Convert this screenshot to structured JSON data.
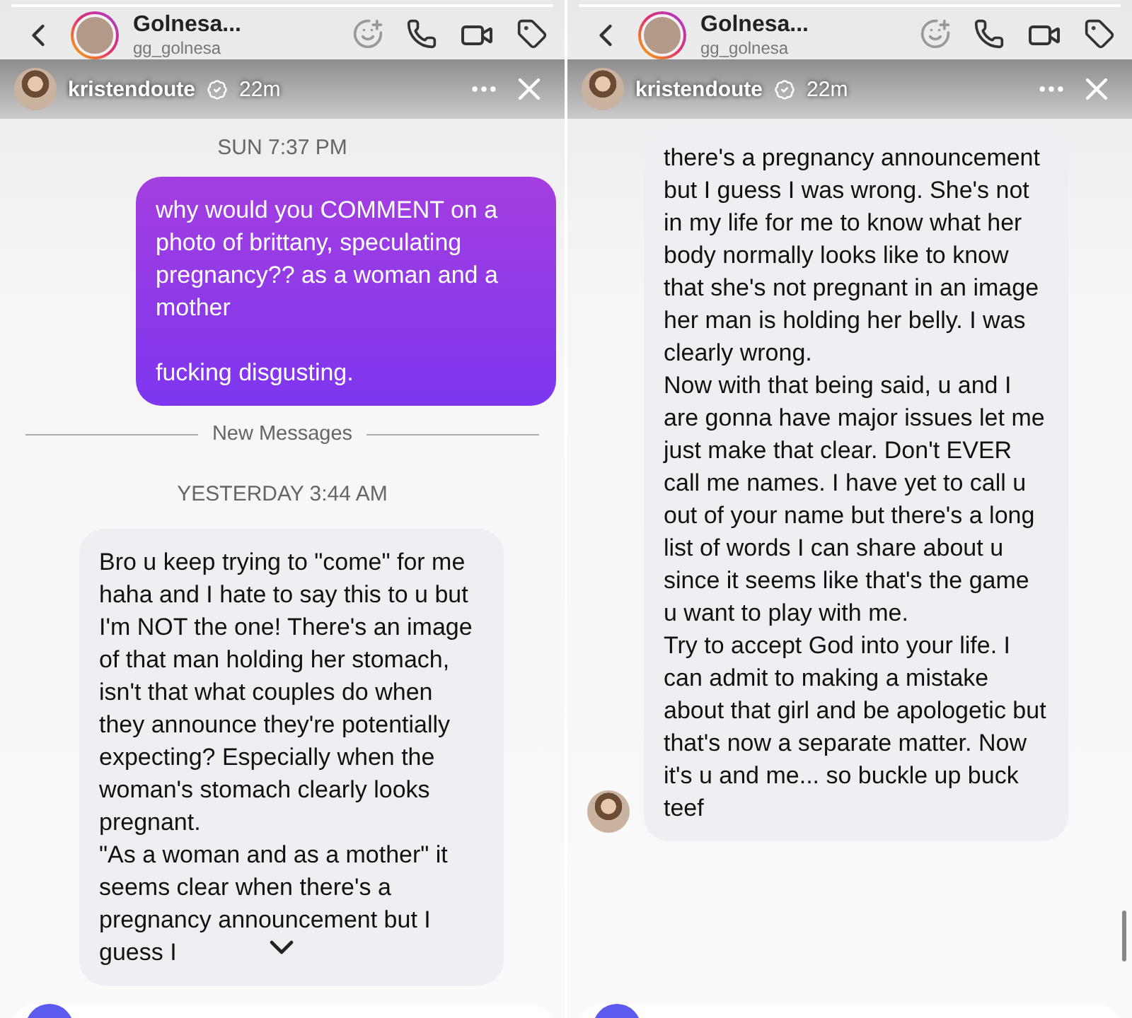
{
  "panels": [
    {
      "story": {
        "username": "kristendoute",
        "time": "22m"
      },
      "conversation": {
        "name": "Golnesa...",
        "username": "gg_golnesa"
      },
      "jump_button": true,
      "messages": [
        {
          "kind": "timestamp",
          "text": "SUN 7:37 PM"
        },
        {
          "kind": "outgoing",
          "text": "why would you COMMENT on a photo of brittany, speculating pregnancy?? as a woman and a mother\n\nfucking disgusting."
        },
        {
          "kind": "divider",
          "text": "New Messages"
        },
        {
          "kind": "timestamp",
          "text": "YESTERDAY 3:44 AM"
        },
        {
          "kind": "incoming",
          "show_avatar": false,
          "text": "Bro u keep trying to \"come\" for me haha and I hate to say this to u but I'm NOT the one! There's an image of that man holding her stomach, isn't that what couples do when they announce they're potentially expecting? Especially when the woman's stomach clearly looks pregnant.\n\"As a woman and as a mother\" it seems clear when there's a pregnancy announcement but I guess I"
        }
      ]
    },
    {
      "story": {
        "username": "kristendoute",
        "time": "22m"
      },
      "conversation": {
        "name": "Golnesa...",
        "username": "gg_golnesa"
      },
      "messages": [
        {
          "kind": "incoming",
          "show_avatar": true,
          "text": "there's a pregnancy announcement but I guess I was wrong. She's not in my life for me to know what her body normally looks like to know that she's not pregnant in an image her man is holding her belly. I was clearly wrong.\nNow with that being said, u and I are gonna have major issues let me just make that clear. Don't EVER call me names. I have yet to call u out of your name but there's a long list of words I can share about u since it seems like that's the game u want to play with me.\nTry to accept God into your life. I can admit to making a mistake about that girl and be apologetic but that's now a separate matter. Now it's u and me... so buckle up buck teef"
        }
      ]
    }
  ]
}
